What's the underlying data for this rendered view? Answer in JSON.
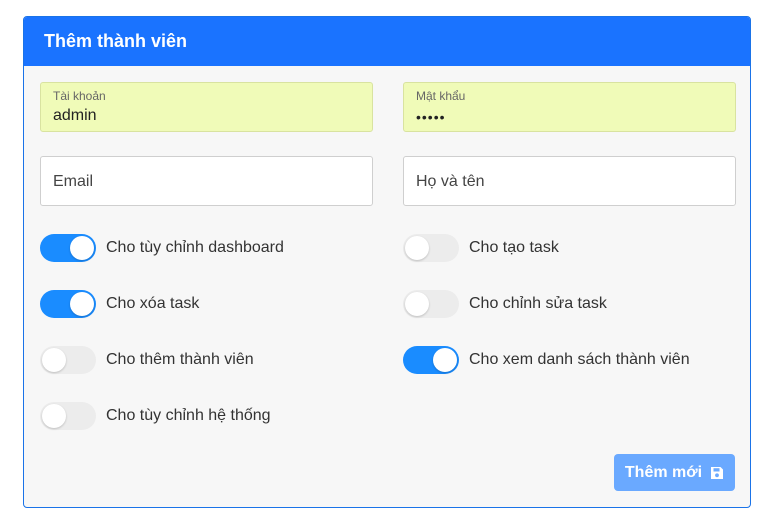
{
  "header": {
    "title": "Thêm thành viên"
  },
  "form": {
    "account": {
      "label": "Tài khoản",
      "value": "admin"
    },
    "password": {
      "label": "Mật khẩu",
      "value": "•••••"
    },
    "email": {
      "placeholder": "Email"
    },
    "fullname": {
      "placeholder": "Họ và tên"
    }
  },
  "permissions": [
    {
      "label": "Cho tùy chỉnh dashboard",
      "on": true
    },
    {
      "label": "Cho tạo task",
      "on": false
    },
    {
      "label": "Cho xóa task",
      "on": true
    },
    {
      "label": "Cho chỉnh sửa task",
      "on": false
    },
    {
      "label": "Cho thêm thành viên",
      "on": false
    },
    {
      "label": "Cho xem danh sách thành viên",
      "on": true
    },
    {
      "label": "Cho tùy chỉnh hệ thống",
      "on": false
    }
  ],
  "actions": {
    "submit_label": "Thêm mới",
    "submit_icon": "floppy-disk-icon"
  },
  "colors": {
    "header": "#1a73ff",
    "switch_on": "#1a8cff",
    "button": "#6aa9ff",
    "filled_field": "#f0fbb8"
  }
}
